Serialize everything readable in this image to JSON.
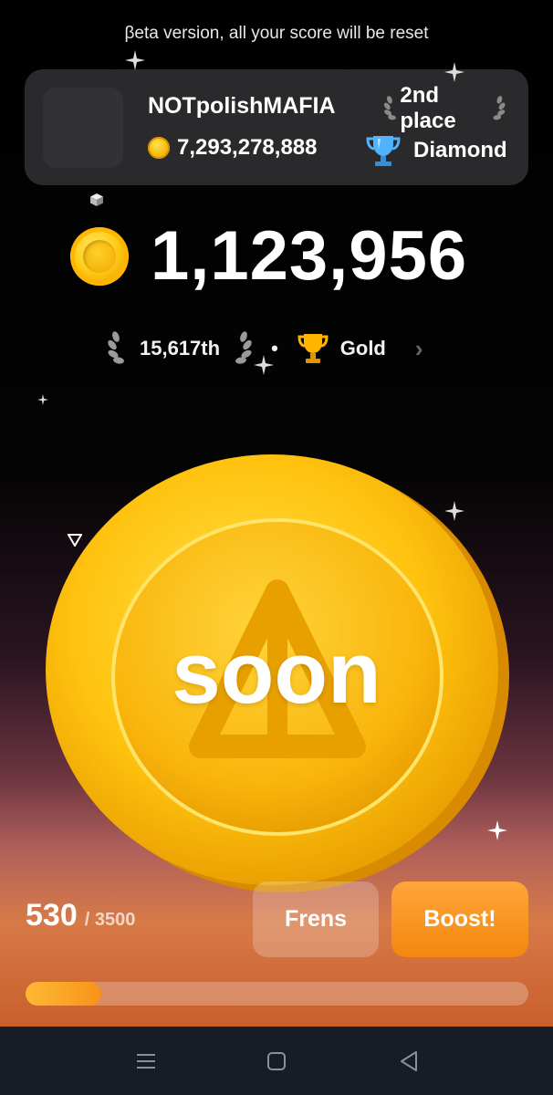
{
  "banner": {
    "text": "βeta version, all your score will be reset"
  },
  "profile": {
    "name": "NOTpolishMAFIA",
    "place": "2nd place",
    "coins": "7,293,278,888",
    "league": "Diamond"
  },
  "balance": {
    "value": "1,123,956"
  },
  "rank": {
    "position": "15,617th",
    "separator": "•",
    "league": "Gold"
  },
  "coin": {
    "overlay_text": "soon"
  },
  "energy": {
    "current": "530",
    "max": "/ 3500",
    "progress_fraction": 0.151
  },
  "buttons": {
    "frens": "Frens",
    "boost": "Boost!"
  },
  "navbar": {
    "items": [
      "menu-icon",
      "home-icon",
      "back-icon"
    ]
  },
  "colors": {
    "coin_gold": "#ffc61a",
    "boost_orange": "#f59a2a",
    "diamond_blue": "#3fa9ff"
  }
}
